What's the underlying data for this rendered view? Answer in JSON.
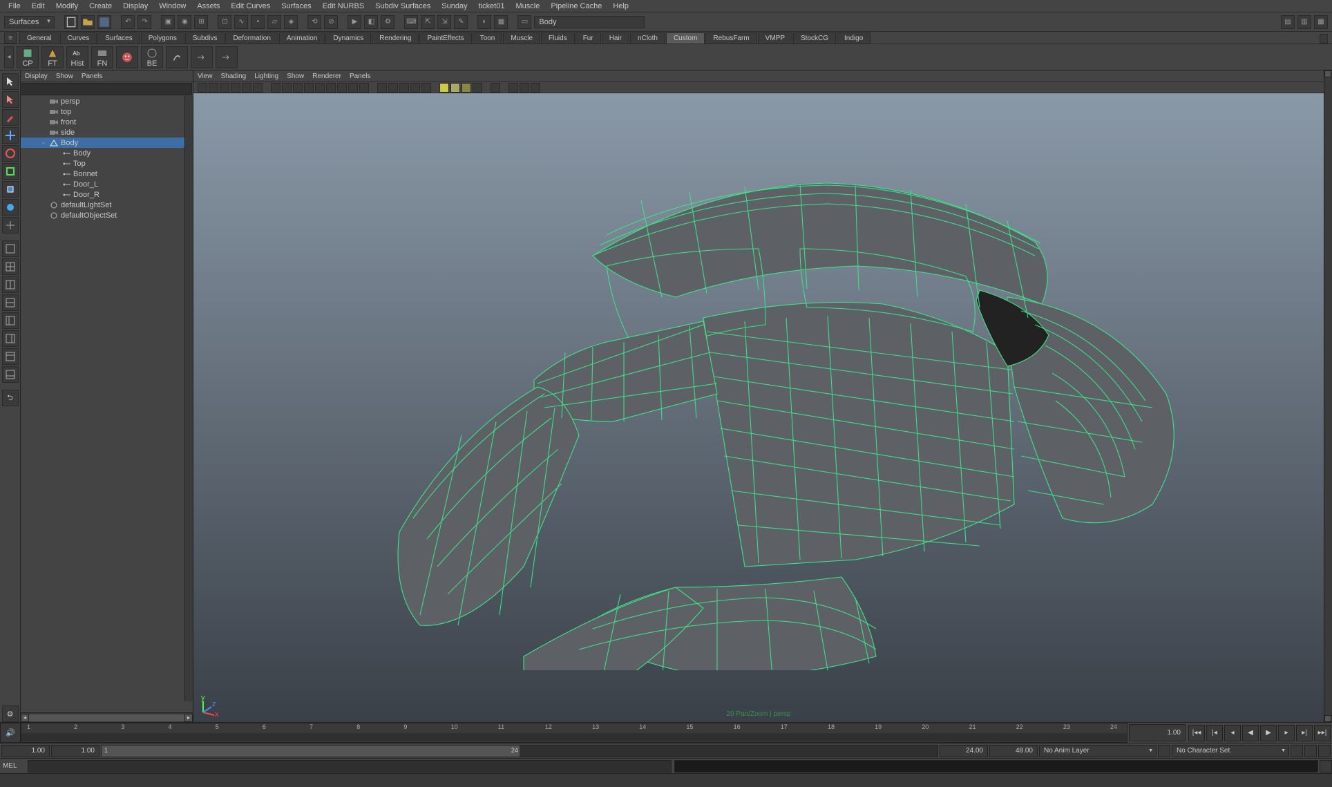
{
  "menubar": [
    "File",
    "Edit",
    "Modify",
    "Create",
    "Display",
    "Window",
    "Assets",
    "Edit Curves",
    "Surfaces",
    "Edit NURBS",
    "Subdiv Surfaces",
    "Sunday",
    "ticket01",
    "Muscle",
    "Pipeline Cache",
    "Help"
  ],
  "status": {
    "module_selector": "Surfaces",
    "object_name": "Body"
  },
  "shelf_tabs": [
    "General",
    "Curves",
    "Surfaces",
    "Polygons",
    "Subdivs",
    "Deformation",
    "Animation",
    "Dynamics",
    "Rendering",
    "PaintEffects",
    "Toon",
    "Muscle",
    "Fluids",
    "Fur",
    "Hair",
    "nCloth",
    "Custom",
    "RebusFarm",
    "VMPP",
    "StockCG",
    "Indigo"
  ],
  "shelf_active_tab": "Custom",
  "shelf_buttons": [
    "CP",
    "FT",
    "Hist",
    "FN",
    "",
    "BE",
    "",
    "",
    ""
  ],
  "outliner": {
    "menus": [
      "Display",
      "Show",
      "Panels"
    ],
    "items": [
      {
        "label": "persp",
        "dim": true,
        "indent": 1,
        "icon": "camera"
      },
      {
        "label": "top",
        "dim": true,
        "indent": 1,
        "icon": "camera"
      },
      {
        "label": "front",
        "dim": true,
        "indent": 1,
        "icon": "camera"
      },
      {
        "label": "side",
        "dim": true,
        "indent": 1,
        "icon": "camera"
      },
      {
        "label": "Body",
        "selected": true,
        "indent": 1,
        "icon": "transform",
        "expand": "-"
      },
      {
        "label": "Body",
        "indent": 2,
        "icon": "shape"
      },
      {
        "label": "Top",
        "indent": 2,
        "icon": "shape"
      },
      {
        "label": "Bonnet",
        "indent": 2,
        "icon": "shape"
      },
      {
        "label": "Door_L",
        "indent": 2,
        "icon": "shape"
      },
      {
        "label": "Door_R",
        "indent": 2,
        "icon": "shape"
      },
      {
        "label": "defaultLightSet",
        "indent": 1,
        "icon": "set"
      },
      {
        "label": "defaultObjectSet",
        "indent": 1,
        "icon": "set"
      }
    ]
  },
  "viewport": {
    "menus": [
      "View",
      "Shading",
      "Lighting",
      "Show",
      "Renderer",
      "Panels"
    ],
    "hud": "20 Pan/Zoom | persp",
    "axis": {
      "x": "x",
      "y": "y",
      "z": "z"
    }
  },
  "timeline": {
    "ticks": [
      "1",
      "2",
      "3",
      "4",
      "5",
      "6",
      "7",
      "8",
      "9",
      "10",
      "11",
      "12",
      "13",
      "14",
      "15",
      "16",
      "17",
      "18",
      "19",
      "20",
      "21",
      "22",
      "23",
      "24"
    ],
    "current_frame": "1.00"
  },
  "range": {
    "start": "1.00",
    "playback_start": "1.00",
    "playback_start_label": "1",
    "playback_end_label": "24",
    "playback_end": "24.00",
    "end": "48.00",
    "anim_layer": "No Anim Layer",
    "character_set": "No Character Set"
  },
  "command": {
    "label": "MEL"
  }
}
